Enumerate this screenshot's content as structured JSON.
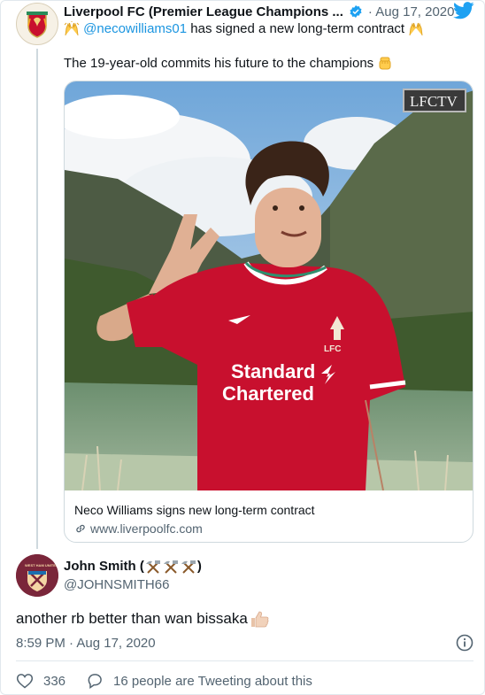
{
  "tweet": {
    "author_name": "Liverpool FC (Premier League Champions ...",
    "date": "Aug 17, 2020",
    "announce_mention": "@necowilliams01",
    "announce_text": "has signed a new long-term contract",
    "body": "The 19-year-old commits his future to the champions",
    "card": {
      "badge": "LFCTV",
      "sponsor_line1": "Standard",
      "sponsor_line2": "Chartered",
      "crest_text": "LFC",
      "title": "Neco Williams signs new long-term contract",
      "link": "www.liverpoolfc.com"
    }
  },
  "reply": {
    "name": "John Smith (",
    "name_close": ")",
    "handle": "@JOHNSMITH66",
    "crest_text": "WEST HAM UNITED",
    "text": "another rb better than wan bissaka",
    "time": "8:59 PM · Aug 17, 2020",
    "likes": "336",
    "conversation": "16 people are Tweeting about this"
  },
  "icons": {
    "verified": "verified-badge-icon",
    "twitter": "twitter-bird-icon",
    "link": "link-icon",
    "like": "heart-icon",
    "reply": "speech-bubble-icon",
    "info": "info-icon",
    "emoji": [
      "raising-hands-icon",
      "raised-fist-icon",
      "hammer-and-pick-icon",
      "thumbs-up-icon"
    ]
  },
  "colors": {
    "twitter_blue": "#1da1f2",
    "link_blue": "#1b95e0",
    "lfc_red": "#c8102e",
    "whu_claret": "#7a263a",
    "muted_text": "#536471"
  }
}
